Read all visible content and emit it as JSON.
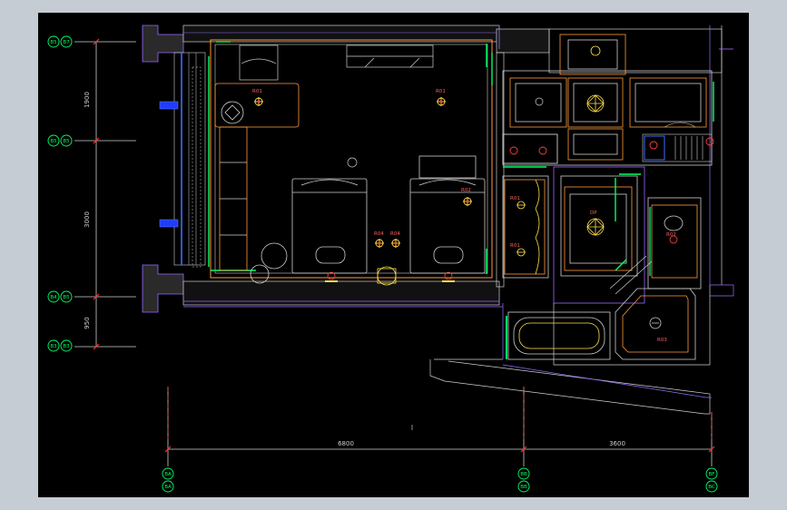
{
  "drawing": {
    "vertical_dimensions": [
      "1900",
      "3000",
      "950"
    ],
    "horizontal_dimensions": [
      "6800",
      "3600"
    ],
    "axis_left": [
      {
        "a": "B5",
        "b": "B7"
      },
      {
        "a": "B5",
        "b": "B5"
      },
      {
        "a": "B4",
        "b": "B5"
      },
      {
        "a": "B3",
        "b": "B3"
      }
    ],
    "axis_bottom": [
      {
        "a": "BA",
        "b": "BA"
      },
      {
        "a": "BB",
        "b": "BB"
      },
      {
        "a": "BF",
        "b": "BC"
      }
    ],
    "fixture_tags": {
      "r01_a": "R01",
      "r01_b": "R01",
      "r02": "R02",
      "r04_a": "R04",
      "r04_b": "R04",
      "dp_main": "DP",
      "r03": "R03",
      "r02_small": "R02",
      "r01_wash_a": "R01",
      "r01_wash_b": "R01"
    }
  }
}
